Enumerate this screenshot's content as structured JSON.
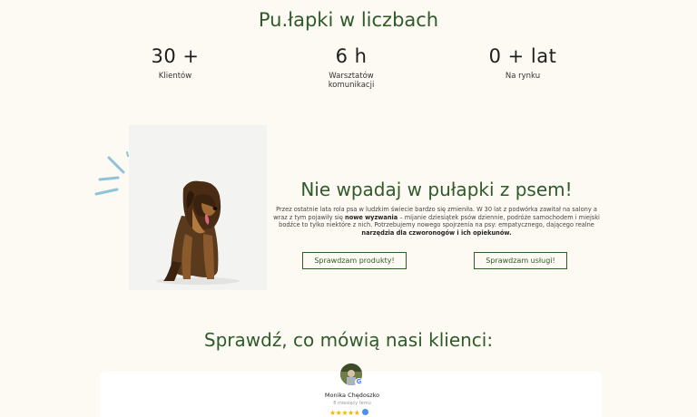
{
  "stats": {
    "title": "Pu.łapki w liczbach",
    "items": [
      {
        "value": "30 +",
        "label": "Klientów"
      },
      {
        "value": "6 h",
        "label_line1": "Warsztatów",
        "label_line2": "komunikacji"
      },
      {
        "value": "0 + lat",
        "label": "Na rynku"
      }
    ]
  },
  "promo": {
    "title": "Nie wpadaj w pułapki z psem!",
    "text_part1": "Przez ostatnie lata rola psa w ludzkim świecie bardzo się zmieniła. W 30 lat z podwórka zawitał na salony a wraz z tym pojawiły się ",
    "text_bold1": "nowe wyzwania",
    "text_part2": " – mijanie dziesiątek psów dziennie, podróże samochodem i miejski bodźce to tylko niektóre z nich. Potrzebujemy nowego spojrzenia na psy: empatycznego, dającego realne ",
    "text_bold2": "narzędzia dla czworonogów i ich opiekunów.",
    "button_products": "Sprawdzam produkty!",
    "button_services": "Sprawdzam usługi!"
  },
  "reviews": {
    "title": "Sprawdź, co mówią nasi klienci:",
    "first": {
      "name": "Monika Chędoszko",
      "time": "8 miesięcy temu",
      "rating": 5,
      "badge": "G"
    }
  },
  "colors": {
    "accent_green": "#2f5a2a",
    "background": "#fdfaf3",
    "star": "#f7b500",
    "sparkle": "#8fc3d8"
  }
}
